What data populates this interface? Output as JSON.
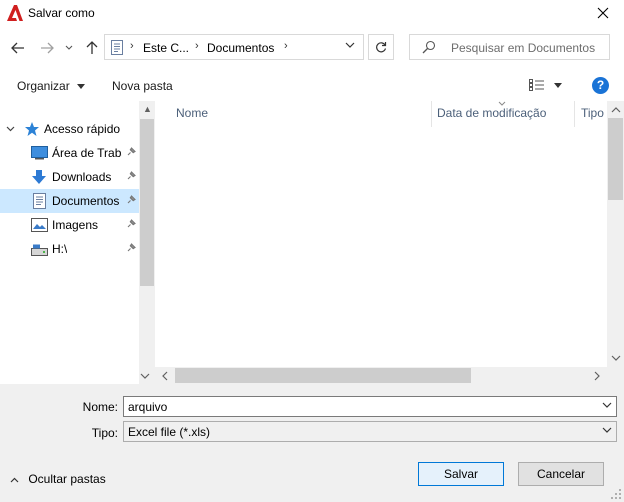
{
  "window": {
    "title": "Salvar como",
    "close_glyph": "✕"
  },
  "address": {
    "crumbs": [
      "Este C...",
      "Documentos"
    ],
    "sep": "›"
  },
  "search": {
    "placeholder": "Pesquisar em Documentos"
  },
  "toolbar": {
    "organize": "Organizar",
    "new_folder": "Nova pasta",
    "help": "?"
  },
  "nav": {
    "quick_access": "Acesso rápido",
    "items": [
      {
        "label": "Área de Traba",
        "icon": "desktop-icon"
      },
      {
        "label": "Downloads",
        "icon": "download-icon"
      },
      {
        "label": "Documentos",
        "icon": "document-icon",
        "selected": true
      },
      {
        "label": "Imagens",
        "icon": "pictures-icon"
      },
      {
        "label": "H:\\",
        "icon": "drive-icon"
      }
    ]
  },
  "columns": {
    "name": "Nome",
    "modified": "Data de modificação",
    "type": "Tipo"
  },
  "form": {
    "name_label": "Nome:",
    "name_value": "arquivo",
    "type_label": "Tipo:",
    "type_value": "Excel file (*.xls)"
  },
  "footer": {
    "hide_folders": "Ocultar pastas",
    "save": "Salvar",
    "cancel": "Cancelar"
  },
  "colors": {
    "accent": "#0078d7",
    "selected_bg": "#cce8ff",
    "logo_red": "#d01f1f"
  }
}
